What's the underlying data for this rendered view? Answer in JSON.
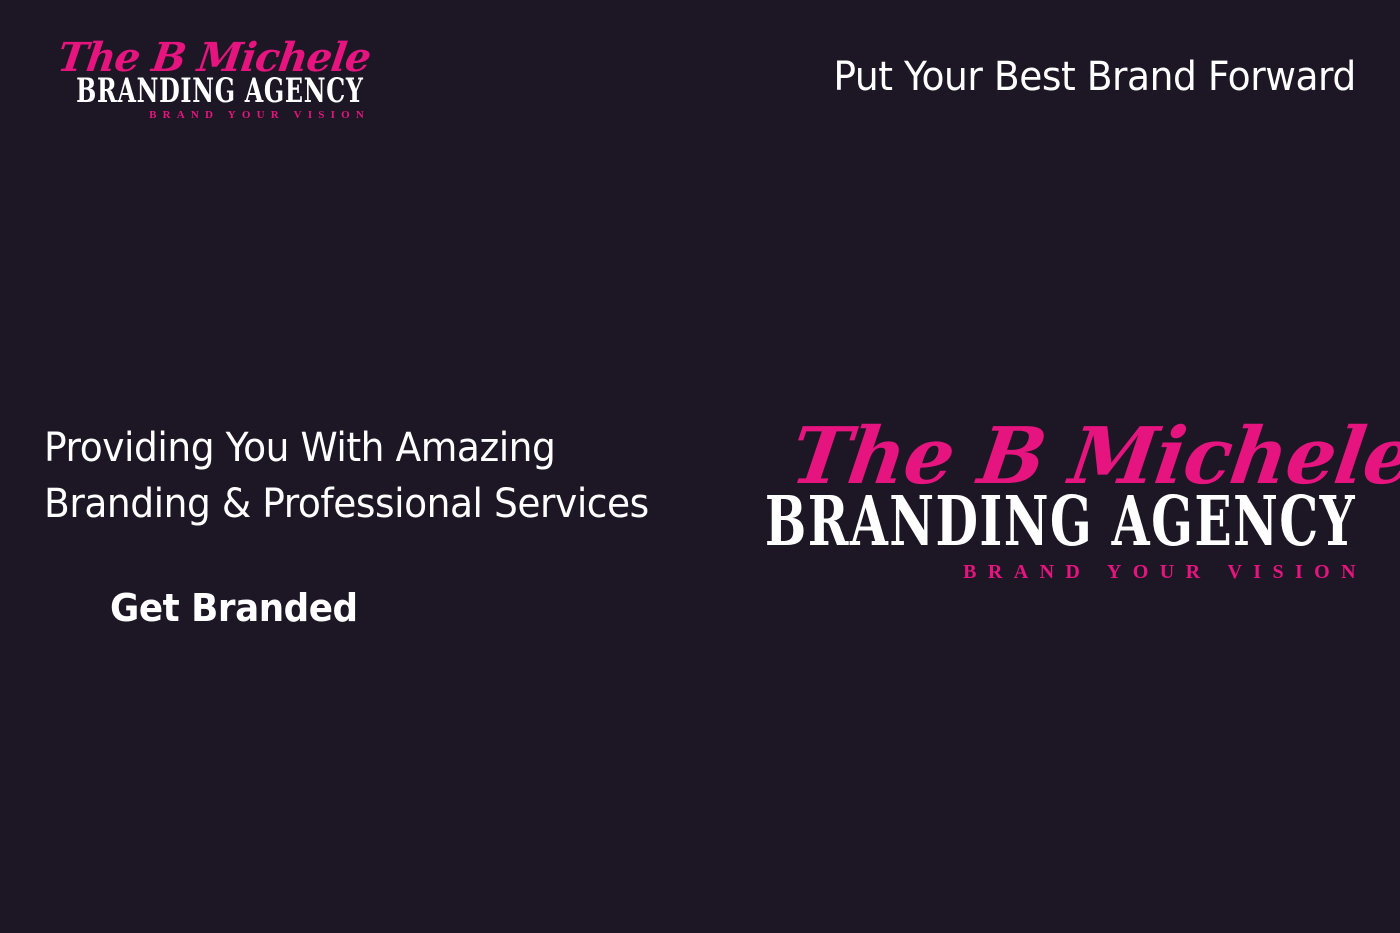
{
  "colors": {
    "background": "#1d1624",
    "accent": "#e6147f",
    "text": "#ffffff"
  },
  "header": {
    "logo": {
      "script": "The B Michele",
      "agency": "BRANDING AGENCY",
      "tagline": "BRAND YOUR VISION"
    },
    "tagline": "Put Your Best Brand Forward"
  },
  "hero": {
    "heading_lines": [
      "Providing You With Amazing",
      "Branding & Professional Services"
    ],
    "cta_label": "Get Branded",
    "logo": {
      "script": "The B Michele",
      "agency": "BRANDING AGENCY",
      "tagline": "BRAND YOUR VISION"
    }
  }
}
